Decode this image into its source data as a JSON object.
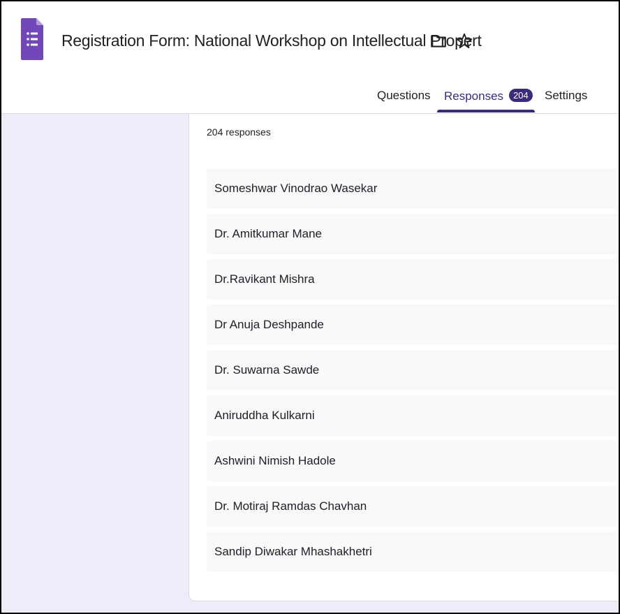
{
  "form": {
    "title": "Registration Form: National Workshop on Intellectual Propert"
  },
  "tabs": {
    "questions": "Questions",
    "responses": "Responses",
    "responses_badge": "204",
    "settings": "Settings"
  },
  "responses": {
    "count_text": "204 responses",
    "items": [
      "Someshwar Vinodrao Wasekar",
      "Dr. Amitkumar Mane",
      "Dr.Ravikant Mishra",
      "Dr Anuja Deshpande",
      "Dr. Suwarna Sawde",
      "Aniruddha Kulkarni",
      "Ashwini Nimish Hadole",
      "Dr. Motiraj Ramdas Chavhan",
      "Sandip Diwakar Mhashakhetri"
    ]
  },
  "icons": {
    "app": "google-forms-icon",
    "folder": "folder-icon",
    "star": "star-icon"
  },
  "colors": {
    "accent": "#3c2a7a",
    "forms_purple": "#7248b9",
    "page_background": "#f0ebf8"
  }
}
